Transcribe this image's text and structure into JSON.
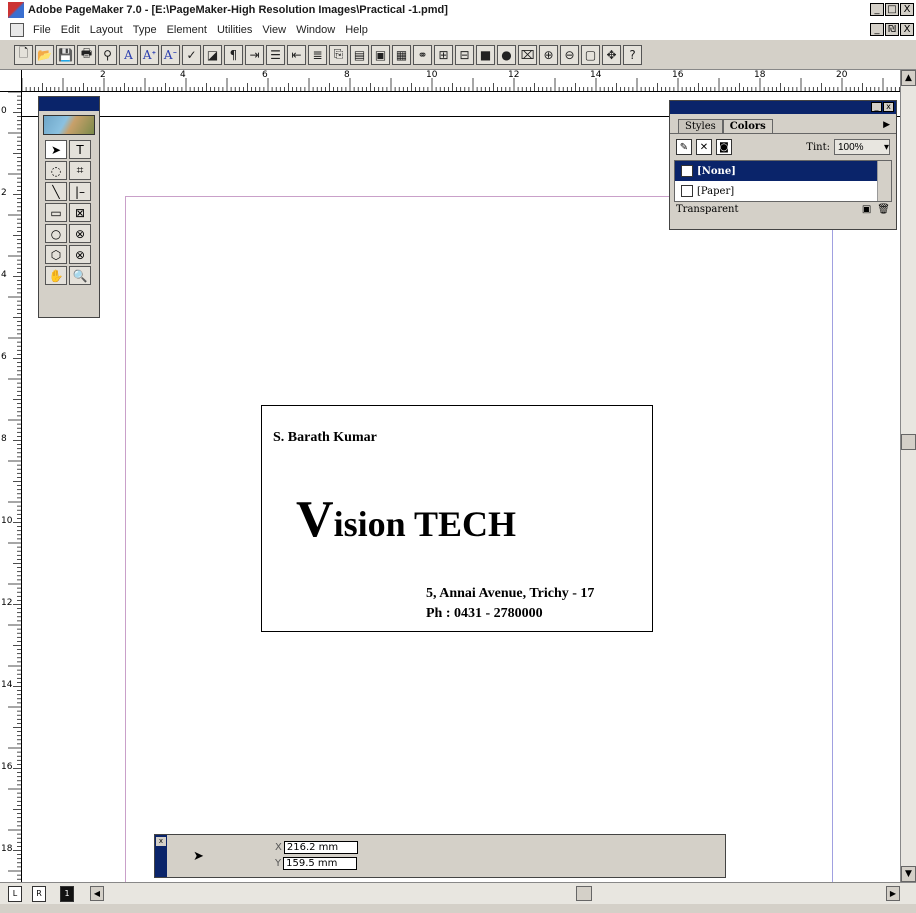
{
  "window": {
    "title": "Adobe PageMaker 7.0 - [E:\\PageMaker-High Resolution Images\\Practical -1.pmd]",
    "controls": [
      "_",
      "□",
      "X"
    ],
    "doc_controls": [
      "_",
      "₪",
      "X"
    ]
  },
  "menu": [
    "File",
    "Edit",
    "Layout",
    "Type",
    "Element",
    "Utilities",
    "View",
    "Window",
    "Help"
  ],
  "toolbar_icons": [
    "new-icon",
    "open-icon",
    "save-icon",
    "print-icon",
    "find-icon",
    "font-icon",
    "font-larger-icon",
    "font-smaller-icon",
    "spell-icon",
    "frame-icon",
    "paragraph-icon",
    "indent-icon",
    "bullets-icon",
    "outdent-icon",
    "indent-right-icon",
    "copy-icon",
    "paste-icon",
    "export-icon",
    "import-icon",
    "link-icon",
    "place-icon",
    "pdf-icon",
    "color-icon",
    "globe-icon",
    "acrobat-icon",
    "zoom-in-icon",
    "zoom-out-icon",
    "actual-size-icon",
    "hand-icon",
    "help-icon"
  ],
  "ruler": {
    "h_labels": [
      "2",
      "4",
      "6",
      "8",
      "10",
      "12",
      "14",
      "16",
      "18",
      "20"
    ],
    "v_labels": [
      "0",
      "2",
      "4",
      "6",
      "8",
      "10",
      "12",
      "14",
      "16",
      "18"
    ]
  },
  "toolbox": {
    "tools": [
      "pointer-icon",
      "text-tool-icon",
      "rotate-icon",
      "crop-icon",
      "line-icon",
      "constrained-line-icon",
      "rectangle-icon",
      "rectangle-frame-icon",
      "ellipse-icon",
      "ellipse-frame-icon",
      "polygon-icon",
      "polygon-frame-icon",
      "hand-icon",
      "zoom-icon"
    ],
    "glyphs": [
      "➤",
      "T",
      "◌",
      "⌗",
      "╲",
      "|–",
      "▭",
      "⊠",
      "○",
      "⊗",
      "⬡",
      "⊗",
      "✋",
      "🔍"
    ]
  },
  "card": {
    "name": "S. Barath Kumar",
    "brand_initial": "V",
    "brand_rest": "ision TECH",
    "address": "5, Annai Avenue, Trichy - 17",
    "phone": "Ph : 0431 - 2780000"
  },
  "colors_panel": {
    "tabs": [
      "Styles",
      "Colors"
    ],
    "tint_label": "Tint:",
    "tint_value": "100%",
    "items": [
      "[None]",
      "[Paper]"
    ],
    "footer": "Transparent"
  },
  "control_palette": {
    "x_label": "X",
    "x_value": "216.2 mm",
    "y_label": "Y",
    "y_value": "159.5 mm"
  },
  "pages": [
    "L",
    "R",
    "1"
  ]
}
